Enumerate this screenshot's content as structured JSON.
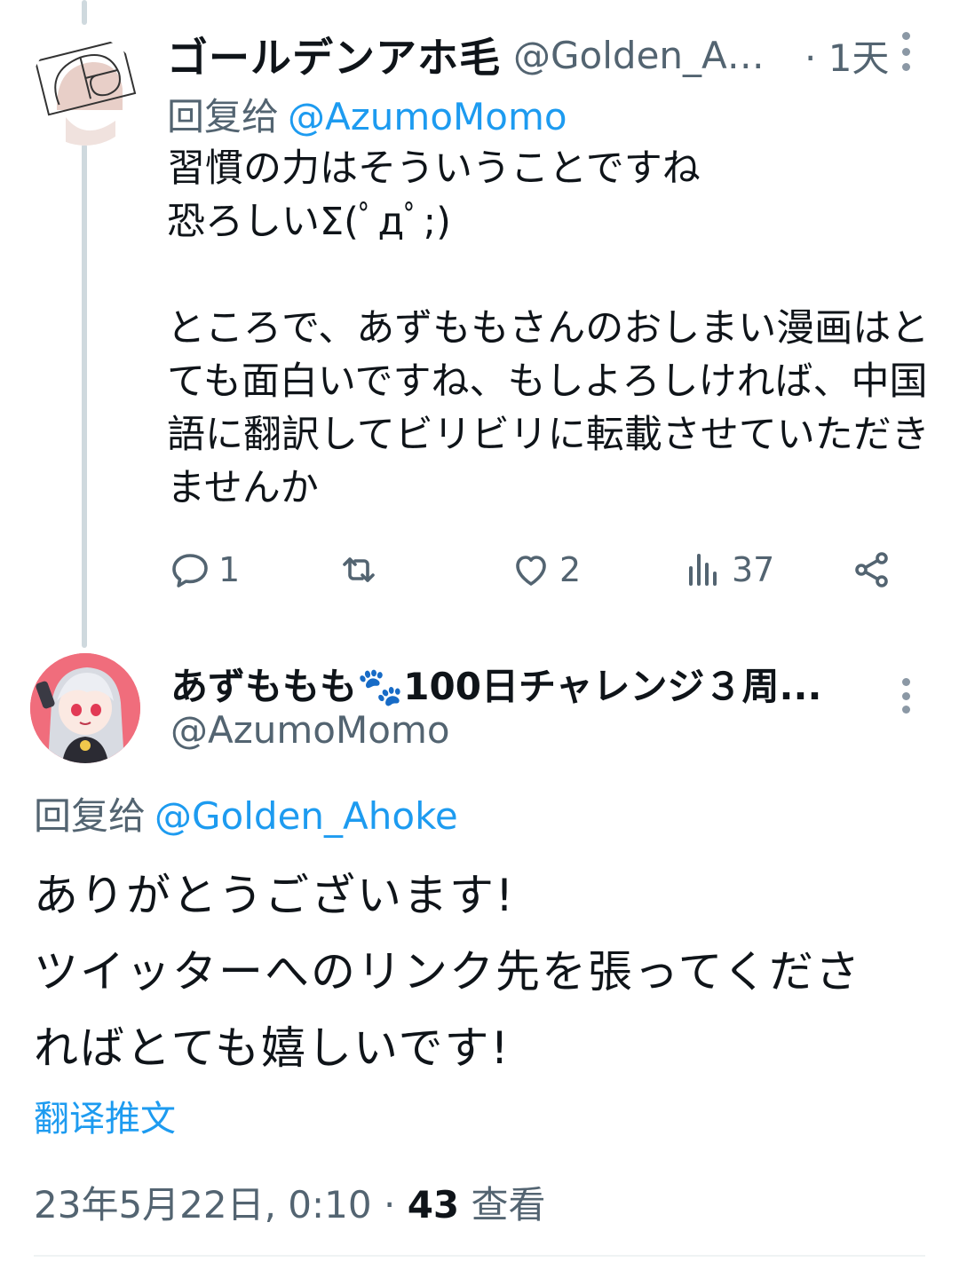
{
  "reply_tweet": {
    "display_name": "ゴールデンアホ毛",
    "handle": "@Golden_Ah...",
    "time": "· 1天",
    "replying_prefix": "回复给",
    "replying_to": "@AzumoMomo",
    "body": "習慣の力はそういうことですね\n恐ろしいΣ(ﾟдﾟ;)\n\nところで、あずももさんのおしまい漫画はとても面白いですね、もしよろしければ、中国語に翻訳してビリビリに転載させていただきませんか",
    "actions": {
      "replies": "1",
      "retweets": "",
      "likes": "2",
      "views": "37"
    },
    "icons": [
      "reply-icon",
      "retweet-icon",
      "like-icon",
      "views-icon",
      "share-icon",
      "more-icon"
    ]
  },
  "main_tweet": {
    "display_name": "あずももも🐾100日チャレンジ３周...",
    "handle": "@AzumoMomo",
    "replying_prefix": "回复给",
    "replying_to": "@Golden_Ahoke",
    "body": "ありがとうございます!\nツイッターへのリンク先を張ってくださ\nればとても嬉しいです!",
    "translate_label": "翻译推文",
    "timestamp": "23年5月22日, 0:10 · ",
    "views_count": "43",
    "views_label": "查看"
  },
  "colors": {
    "link": "#1d9bf0",
    "secondary_text": "#536471",
    "thread_line": "#cfd9de",
    "avatar2_bg": "#f06d7c"
  }
}
